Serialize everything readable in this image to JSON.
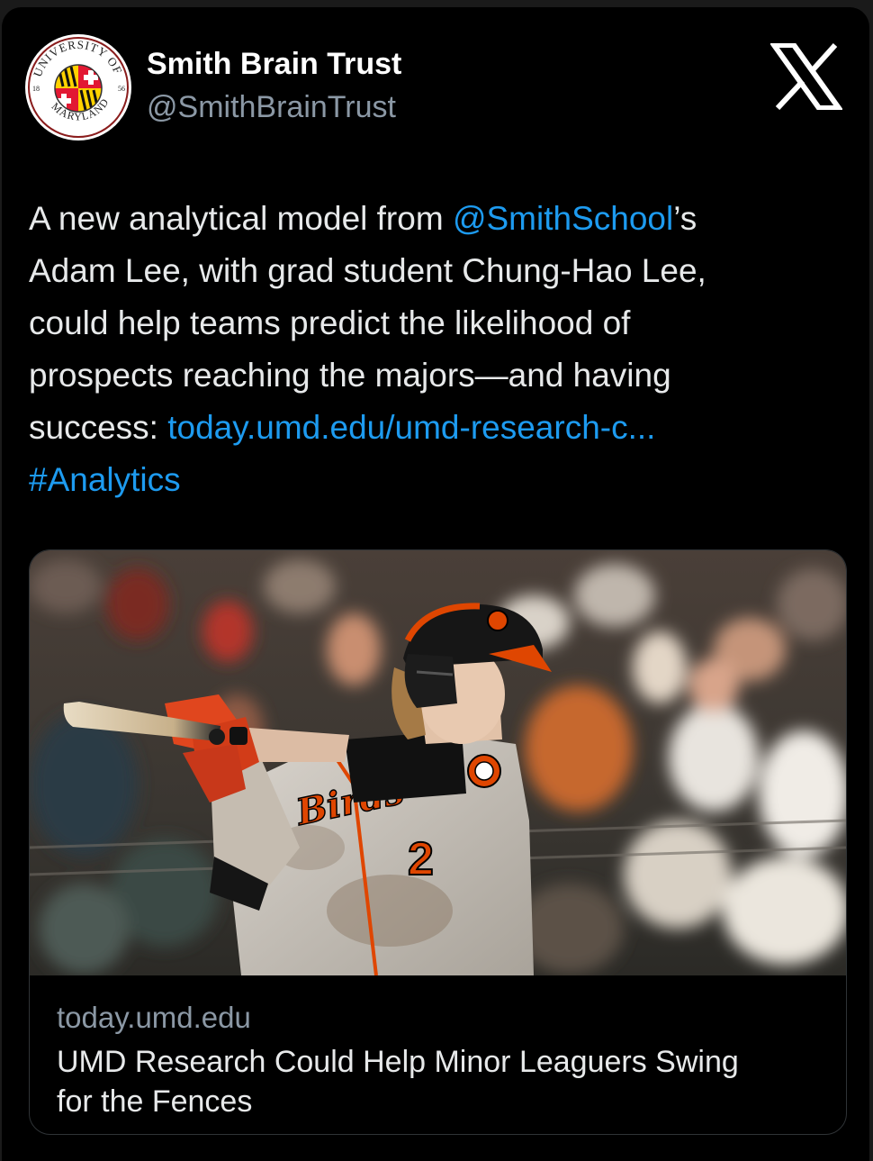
{
  "header": {
    "display_name": "Smith Brain Trust",
    "handle": "@SmithBrainTrust",
    "avatar_icon": "umd-seal-icon",
    "avatar_seal_lettering": "UNIVERSITY OF MARYLAND 18 56",
    "close_icon": "x-logo-icon"
  },
  "tweet": {
    "line1_before": "A new analytical model from ",
    "line1_mention": "@SmithSchool",
    "line1_after": "’s",
    "line2": "Adam Lee, with grad student Chung-Hao Lee,",
    "line3": "could help teams predict the likelihood of",
    "line4": "prospects reaching the majors—and having",
    "line5_before": "success: ",
    "line5_link": "today.umd.edu/umd-research-c...",
    "hashtag": "#Analytics"
  },
  "card": {
    "image_icon": "baseball-batter-photo",
    "jersey_number": "2",
    "domain": "today.umd.edu",
    "title_line1": "UMD Research Could Help Minor Leaguers Swing",
    "title_line2": "for the Fences"
  },
  "colors": {
    "background": "#000000",
    "text": "#e7e9ea",
    "secondary_text": "#8b98a5",
    "link": "#1d9bf0",
    "orioles_orange": "#df4601",
    "maryland_red": "#e21833",
    "maryland_gold": "#ffd200"
  }
}
